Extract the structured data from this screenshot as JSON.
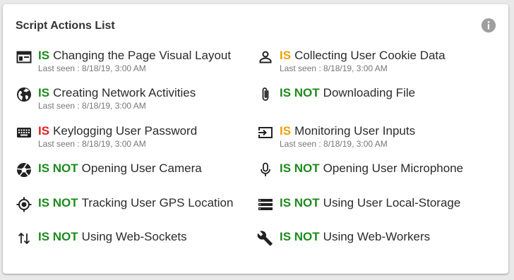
{
  "title": "Script Actions List",
  "colors": {
    "green": "#1e8a1e",
    "orange": "#f0a000",
    "red": "#e02020"
  },
  "items": [
    {
      "icon": "web-layout-icon",
      "status": "IS",
      "status_color": "green",
      "label": "Changing the Page Visual Layout",
      "seen": "Last seen : 8/18/19, 3:00 AM"
    },
    {
      "icon": "person-icon",
      "status": "IS",
      "status_color": "orange",
      "label": "Collecting User Cookie Data",
      "seen": "Last seen : 8/18/19, 3:00 AM"
    },
    {
      "icon": "globe-icon",
      "status": "IS",
      "status_color": "green",
      "label": "Creating Network Activities",
      "seen": "Last seen : 8/18/19, 3:00 AM"
    },
    {
      "icon": "paperclip-icon",
      "status": "IS NOT",
      "status_color": "green",
      "label": "Downloading File",
      "seen": ""
    },
    {
      "icon": "keyboard-icon",
      "status": "IS",
      "status_color": "red",
      "label": "Keylogging User Password",
      "seen": "Last seen : 8/18/19, 3:00 AM"
    },
    {
      "icon": "input-icon",
      "status": "IS",
      "status_color": "orange",
      "label": "Monitoring User Inputs",
      "seen": "Last seen : 8/18/19, 3:00 AM"
    },
    {
      "icon": "camera-shutter-icon",
      "status": "IS NOT",
      "status_color": "green",
      "label": "Opening User Camera",
      "seen": ""
    },
    {
      "icon": "microphone-icon",
      "status": "IS NOT",
      "status_color": "green",
      "label": "Opening User Microphone",
      "seen": ""
    },
    {
      "icon": "gps-target-icon",
      "status": "IS NOT",
      "status_color": "green",
      "label": "Tracking User GPS Location",
      "seen": ""
    },
    {
      "icon": "storage-icon",
      "status": "IS NOT",
      "status_color": "green",
      "label": "Using User Local-Storage",
      "seen": ""
    },
    {
      "icon": "swap-vertical-icon",
      "status": "IS NOT",
      "status_color": "green",
      "label": "Using Web-Sockets",
      "seen": ""
    },
    {
      "icon": "wrench-icon",
      "status": "IS NOT",
      "status_color": "green",
      "label": "Using Web-Workers",
      "seen": ""
    }
  ]
}
